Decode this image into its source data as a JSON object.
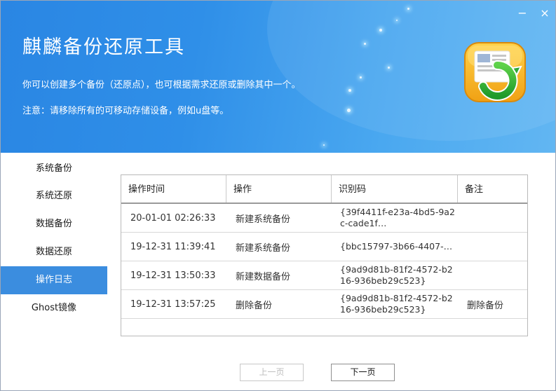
{
  "window": {
    "minimize_glyph": "−",
    "close_glyph": "×"
  },
  "header": {
    "title": "麒麟备份还原工具",
    "description_1": "你可以创建多个备份（还原点），也可根据需求还原或删除其中一个。",
    "description_2": "注意：请移除所有的可移动存储设备，例如u盘等。",
    "logo_icon": "backup-restore-logo-icon"
  },
  "sidebar": {
    "items": [
      {
        "label": "系统备份",
        "active": false
      },
      {
        "label": "系统还原",
        "active": false
      },
      {
        "label": "数据备份",
        "active": false
      },
      {
        "label": "数据还原",
        "active": false
      },
      {
        "label": "操作日志",
        "active": true
      },
      {
        "label": "Ghost镜像",
        "active": false
      }
    ]
  },
  "log_table": {
    "headers": [
      "操作时间",
      "操作",
      "识别码",
      "备注"
    ],
    "rows": [
      {
        "time": "20-01-01 02:26:33",
        "action": "新建系统备份",
        "id": "{39f4411f-e23a-4bd5-9a2c-cade1f…",
        "note": ""
      },
      {
        "time": "19-12-31 11:39:41",
        "action": "新建系统备份",
        "id": "{bbc15797-3b66-4407-…",
        "note": ""
      },
      {
        "time": "19-12-31 13:50:33",
        "action": "新建数据备份",
        "id": "{9ad9d81b-81f2-4572-b216-936beb29c523}",
        "note": ""
      },
      {
        "time": "19-12-31 13:57:25",
        "action": "删除备份",
        "id": "{9ad9d81b-81f2-4572-b216-936beb29c523}",
        "note": "删除备份"
      }
    ]
  },
  "pagination": {
    "prev_label": "上一页",
    "prev_enabled": false,
    "next_label": "下一页",
    "next_enabled": true
  },
  "colors": {
    "header_blue": "#2f8fe8",
    "active_nav": "#3b8ddf",
    "logo_orange": "#f2a21a",
    "logo_green": "#2fa836"
  }
}
